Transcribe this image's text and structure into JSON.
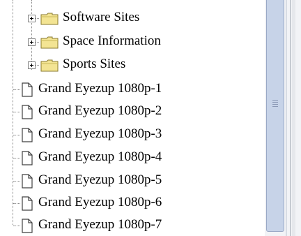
{
  "tree": {
    "folders": [
      {
        "label": "Software Sites",
        "icon": "folder-icon",
        "toggle": "expand-plus-icon"
      },
      {
        "label": "Space Information",
        "icon": "folder-icon",
        "toggle": "expand-plus-icon"
      },
      {
        "label": "Sports Sites",
        "icon": "folder-icon",
        "toggle": "expand-plus-icon"
      }
    ],
    "documents": [
      {
        "label": "Grand Eyezup 1080p-1",
        "icon": "document-icon"
      },
      {
        "label": "Grand Eyezup 1080p-2",
        "icon": "document-icon"
      },
      {
        "label": "Grand Eyezup 1080p-3",
        "icon": "document-icon"
      },
      {
        "label": "Grand Eyezup 1080p-4",
        "icon": "document-icon"
      },
      {
        "label": "Grand Eyezup 1080p-5",
        "icon": "document-icon"
      },
      {
        "label": "Grand Eyezup 1080p-6",
        "icon": "document-icon"
      },
      {
        "label": "Grand Eyezup 1080p-7",
        "icon": "document-icon"
      }
    ]
  },
  "colors": {
    "folder_fill": "#f3e493",
    "folder_outline": "#8a7a2e",
    "scroll_thumb": "#c7d3e8",
    "connector": "#8a8a8a"
  }
}
